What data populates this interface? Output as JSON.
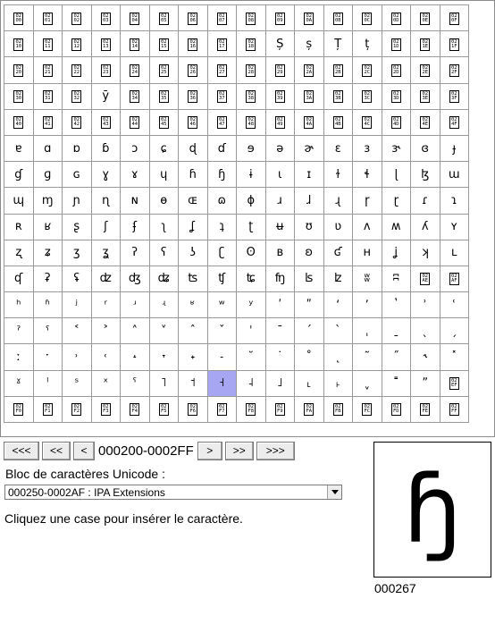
{
  "grid": {
    "selected_index": 231,
    "cells": [
      "hex:02|00",
      "hex:02|01",
      "hex:02|02",
      "hex:02|03",
      "hex:02|04",
      "hex:02|05",
      "hex:02|06",
      "hex:02|07",
      "hex:02|08",
      "hex:02|09",
      "hex:02|0A",
      "hex:02|0B",
      "hex:02|0C",
      "hex:02|0D",
      "hex:02|0E",
      "hex:02|0F",
      "hex:02|10",
      "hex:02|11",
      "hex:02|12",
      "hex:02|13",
      "hex:02|14",
      "hex:02|15",
      "hex:02|16",
      "hex:02|17",
      "hex:02|18",
      "Ș",
      "ș",
      "Ț",
      "ț",
      "hex:02|1D",
      "hex:02|1E",
      "hex:02|1F",
      "hex:02|20",
      "hex:02|21",
      "hex:02|22",
      "hex:02|23",
      "hex:02|24",
      "hex:02|25",
      "hex:02|26",
      "hex:02|27",
      "hex:02|28",
      "hex:02|29",
      "hex:02|2A",
      "hex:02|2B",
      "hex:02|2C",
      "hex:02|2D",
      "hex:02|2E",
      "hex:02|2F",
      "hex:02|30",
      "hex:02|31",
      "hex:02|32",
      "ȳ",
      "hex:02|34",
      "hex:02|35",
      "hex:02|36",
      "hex:02|37",
      "hex:02|38",
      "hex:02|39",
      "hex:02|3A",
      "hex:02|3B",
      "hex:02|3C",
      "hex:02|3D",
      "hex:02|3E",
      "hex:02|3F",
      "hex:02|40",
      "hex:02|41",
      "hex:02|42",
      "hex:02|43",
      "hex:02|44",
      "hex:02|45",
      "hex:02|46",
      "hex:02|47",
      "hex:02|48",
      "hex:02|49",
      "hex:02|4A",
      "hex:02|4B",
      "hex:02|4C",
      "hex:02|4D",
      "hex:02|4E",
      "hex:02|4F",
      "ɐ",
      "ɑ",
      "ɒ",
      "ɓ",
      "ɔ",
      "ɕ",
      "ɖ",
      "ɗ",
      "ɘ",
      "ə",
      "ɚ",
      "ɛ",
      "ɜ",
      "ɝ",
      "ɞ",
      "ɟ",
      "ɠ",
      "ɡ",
      "ɢ",
      "ɣ",
      "ɤ",
      "ɥ",
      "ɦ",
      "ɧ",
      "ɨ",
      "ɩ",
      "ɪ",
      "ɫ",
      "ɬ",
      "ɭ",
      "ɮ",
      "ɯ",
      "ɰ",
      "ɱ",
      "ɲ",
      "ɳ",
      "ɴ",
      "ɵ",
      "ɶ",
      "ɷ",
      "ɸ",
      "ɹ",
      "ɺ",
      "ɻ",
      "ɼ",
      "ɽ",
      "ɾ",
      "ɿ",
      "ʀ",
      "ʁ",
      "ʂ",
      "ʃ",
      "ʄ",
      "ʅ",
      "ʆ",
      "ʇ",
      "ʈ",
      "ʉ",
      "ʊ",
      "ʋ",
      "ʌ",
      "ʍ",
      "ʎ",
      "ʏ",
      "ʐ",
      "ʑ",
      "ʒ",
      "ʓ",
      "ʔ",
      "ʕ",
      "ʖ",
      "ʗ",
      "ʘ",
      "ʙ",
      "ʚ",
      "ʛ",
      "ʜ",
      "ʝ",
      "ʞ",
      "ʟ",
      "ʠ",
      "ʡ",
      "ʢ",
      "ʣ",
      "ʤ",
      "ʥ",
      "ʦ",
      "ʧ",
      "ʨ",
      "ʩ",
      "ʪ",
      "ʫ",
      "ʬ",
      "ʭ",
      "hex:02|AE",
      "hex:02|AF",
      "ʰ",
      "ʱ",
      "ʲ",
      "ʳ",
      "ʴ",
      "ʵ",
      "ʶ",
      "ʷ",
      "ʸ",
      "ʹ",
      "ʺ",
      "ʻ",
      "ʼ",
      "ʽ",
      "ʾ",
      "ʿ",
      "ˀ",
      "ˁ",
      "˂",
      "˃",
      "˄",
      "˅",
      "ˆ",
      "ˇ",
      "ˈ",
      "ˉ",
      "ˊ",
      "ˋ",
      "ˌ",
      "ˍ",
      "ˎ",
      "ˏ",
      "ː",
      "ˑ",
      "˒",
      "˓",
      "˔",
      "˕",
      "˖",
      "˗",
      "˘",
      "˙",
      "˚",
      "˛",
      "˜",
      "˝",
      "˞",
      "˟",
      "ˠ",
      "ˡ",
      "ˢ",
      "ˣ",
      "ˤ",
      "˥",
      "˦",
      "˧",
      "˨",
      "˩",
      "˪",
      "˫",
      "ˬ",
      "˭",
      "ˮ",
      "hex:02|EF",
      "hex:02|F0",
      "hex:02|F1",
      "hex:02|F2",
      "hex:02|F3",
      "hex:02|F4",
      "hex:02|F5",
      "hex:02|F6",
      "hex:02|F7",
      "hex:02|F8",
      "hex:02|F9",
      "hex:02|FA",
      "hex:02|FB",
      "hex:02|FC",
      "hex:02|FD",
      "hex:02|FE",
      "hex:02|FF"
    ]
  },
  "nav": {
    "first_label": "<<<",
    "prev_big_label": "<<",
    "prev_label": "<",
    "range": "000200-0002FF",
    "next_label": ">",
    "next_big_label": ">>",
    "last_label": ">>>"
  },
  "block": {
    "label": "Bloc de caractères Unicode :",
    "selected": "000250-0002AF : IPA Extensions"
  },
  "hint": "Cliquez une case pour insérer le caractère.",
  "preview": {
    "glyph": "ɧ",
    "code": "000267"
  },
  "colors": {
    "selected_cell": "#a6a6f2",
    "grid_border": "#9a9a9a"
  }
}
